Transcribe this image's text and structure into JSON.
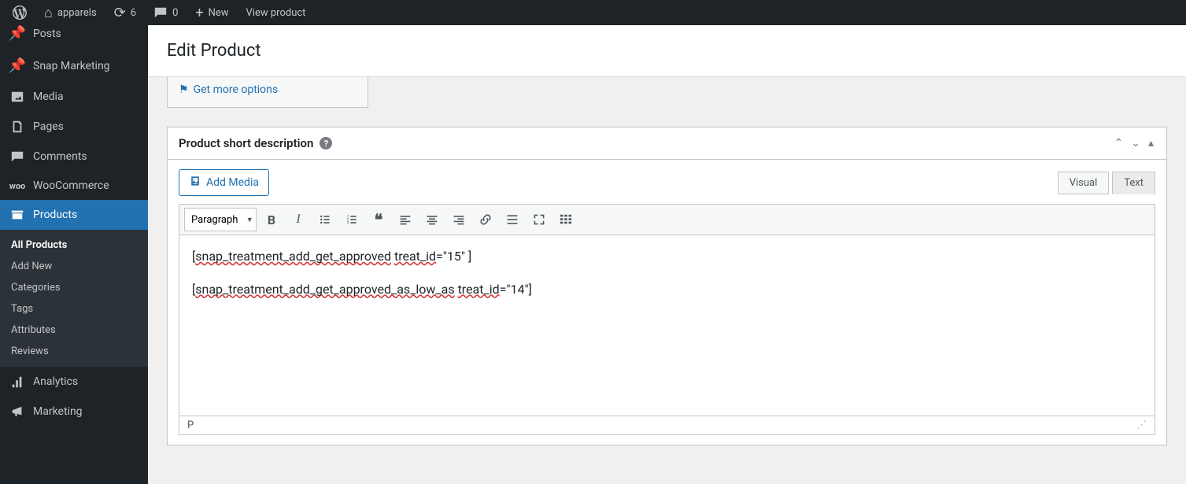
{
  "topbar": {
    "site_name": "apparels",
    "updates_count": "6",
    "comments_count": "0",
    "new_label": "New",
    "view_product_label": "View product"
  },
  "sidebar": {
    "posts_label": "Posts",
    "snap_marketing_label": "Snap Marketing",
    "media_label": "Media",
    "pages_label": "Pages",
    "comments_label": "Comments",
    "woocommerce_label": "WooCommerce",
    "products_label": "Products",
    "analytics_label": "Analytics",
    "marketing_label": "Marketing",
    "products_submenu": {
      "all_products": "All Products",
      "add_new": "Add New",
      "categories": "Categories",
      "tags": "Tags",
      "attributes": "Attributes",
      "reviews": "Reviews"
    }
  },
  "page": {
    "title": "Edit Product",
    "get_more_options": "Get more options"
  },
  "panel": {
    "title": "Product short description",
    "add_media_label": "Add Media",
    "tab_visual": "Visual",
    "tab_text": "Text",
    "format_select": "Paragraph",
    "status_path": "P",
    "content_line1_a": "snap_treatment_add_get_approved",
    "content_line1_b": "treat_id",
    "content_line1_c": "=\"15\" ]",
    "content_line2_a": "snap_treatment_add_get_approved_as_low_as",
    "content_line2_b": "treat_id",
    "content_line2_c": "=\"14\"]"
  }
}
